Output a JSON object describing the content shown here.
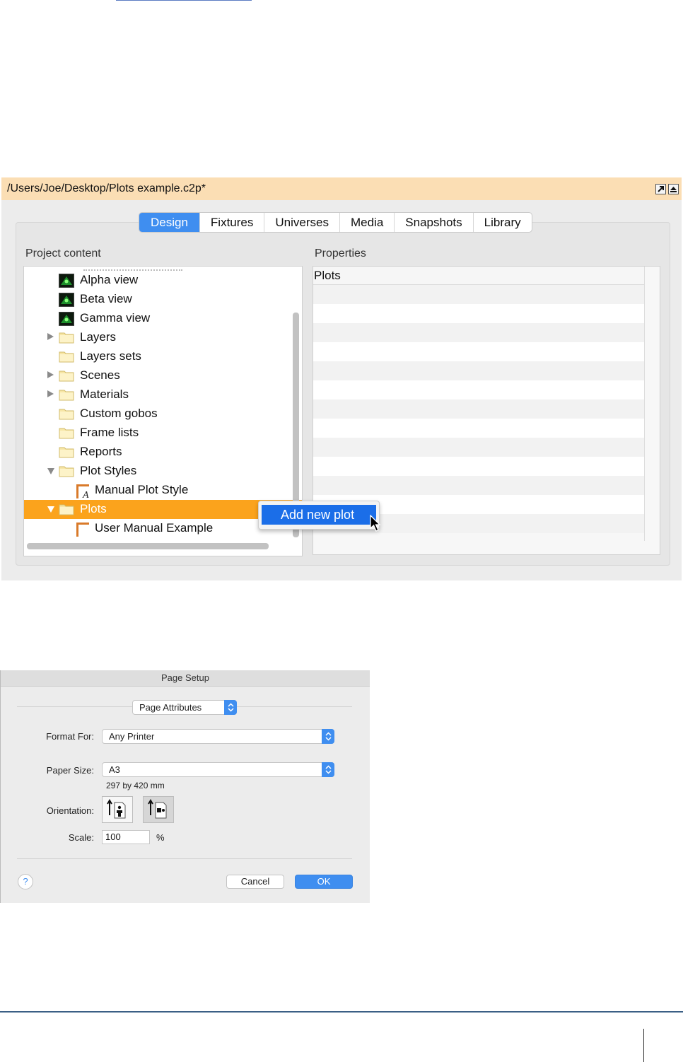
{
  "window": {
    "title": "/Users/Joe/Desktop/Plots example.c2p*",
    "tabs": [
      "Design",
      "Fixtures",
      "Universes",
      "Media",
      "Snapshots",
      "Library"
    ],
    "active_tab": "Design",
    "project_content_label": "Project content",
    "properties_label": "Properties",
    "properties_header": "Plots",
    "tree": [
      {
        "label": "Alpha view",
        "icon": "view-icon",
        "expander": "none"
      },
      {
        "label": "Beta view",
        "icon": "view-icon",
        "expander": "none"
      },
      {
        "label": "Gamma view",
        "icon": "view-icon",
        "expander": "none"
      },
      {
        "label": "Layers",
        "icon": "folder-icon",
        "expander": "collapsed"
      },
      {
        "label": "Layers sets",
        "icon": "folder-icon",
        "expander": "none"
      },
      {
        "label": "Scenes",
        "icon": "folder-icon",
        "expander": "collapsed"
      },
      {
        "label": "Materials",
        "icon": "folder-icon",
        "expander": "collapsed"
      },
      {
        "label": "Custom gobos",
        "icon": "folder-icon",
        "expander": "none"
      },
      {
        "label": "Frame lists",
        "icon": "folder-icon",
        "expander": "none"
      },
      {
        "label": "Reports",
        "icon": "folder-icon",
        "expander": "none"
      },
      {
        "label": "Plot Styles",
        "icon": "folder-icon",
        "expander": "expanded"
      },
      {
        "label": "Manual Plot Style",
        "icon": "plot-style-icon",
        "expander": "none"
      },
      {
        "label": "Plots",
        "icon": "folder-icon",
        "expander": "expanded",
        "selected": true
      },
      {
        "label": "User Manual Example",
        "icon": "plot-icon",
        "expander": "none"
      }
    ],
    "context_menu": {
      "item": "Add new plot"
    },
    "colors": {
      "title_bar": "#fbdeb4",
      "selection": "#fba31c",
      "accent": "#3f8ef0",
      "menu_highlight": "#1b6ee8"
    }
  },
  "page_setup": {
    "title": "Page Setup",
    "settings_popup": "Page Attributes",
    "format_for_label": "Format For:",
    "format_for_value": "Any Printer",
    "paper_size_label": "Paper Size:",
    "paper_size_value": "A3",
    "paper_dims": "297 by 420 mm",
    "orientation_label": "Orientation:",
    "orientation_selected": "landscape",
    "scale_label": "Scale:",
    "scale_value": "100",
    "scale_unit": "%",
    "help_label": "?",
    "cancel_label": "Cancel",
    "ok_label": "OK"
  }
}
